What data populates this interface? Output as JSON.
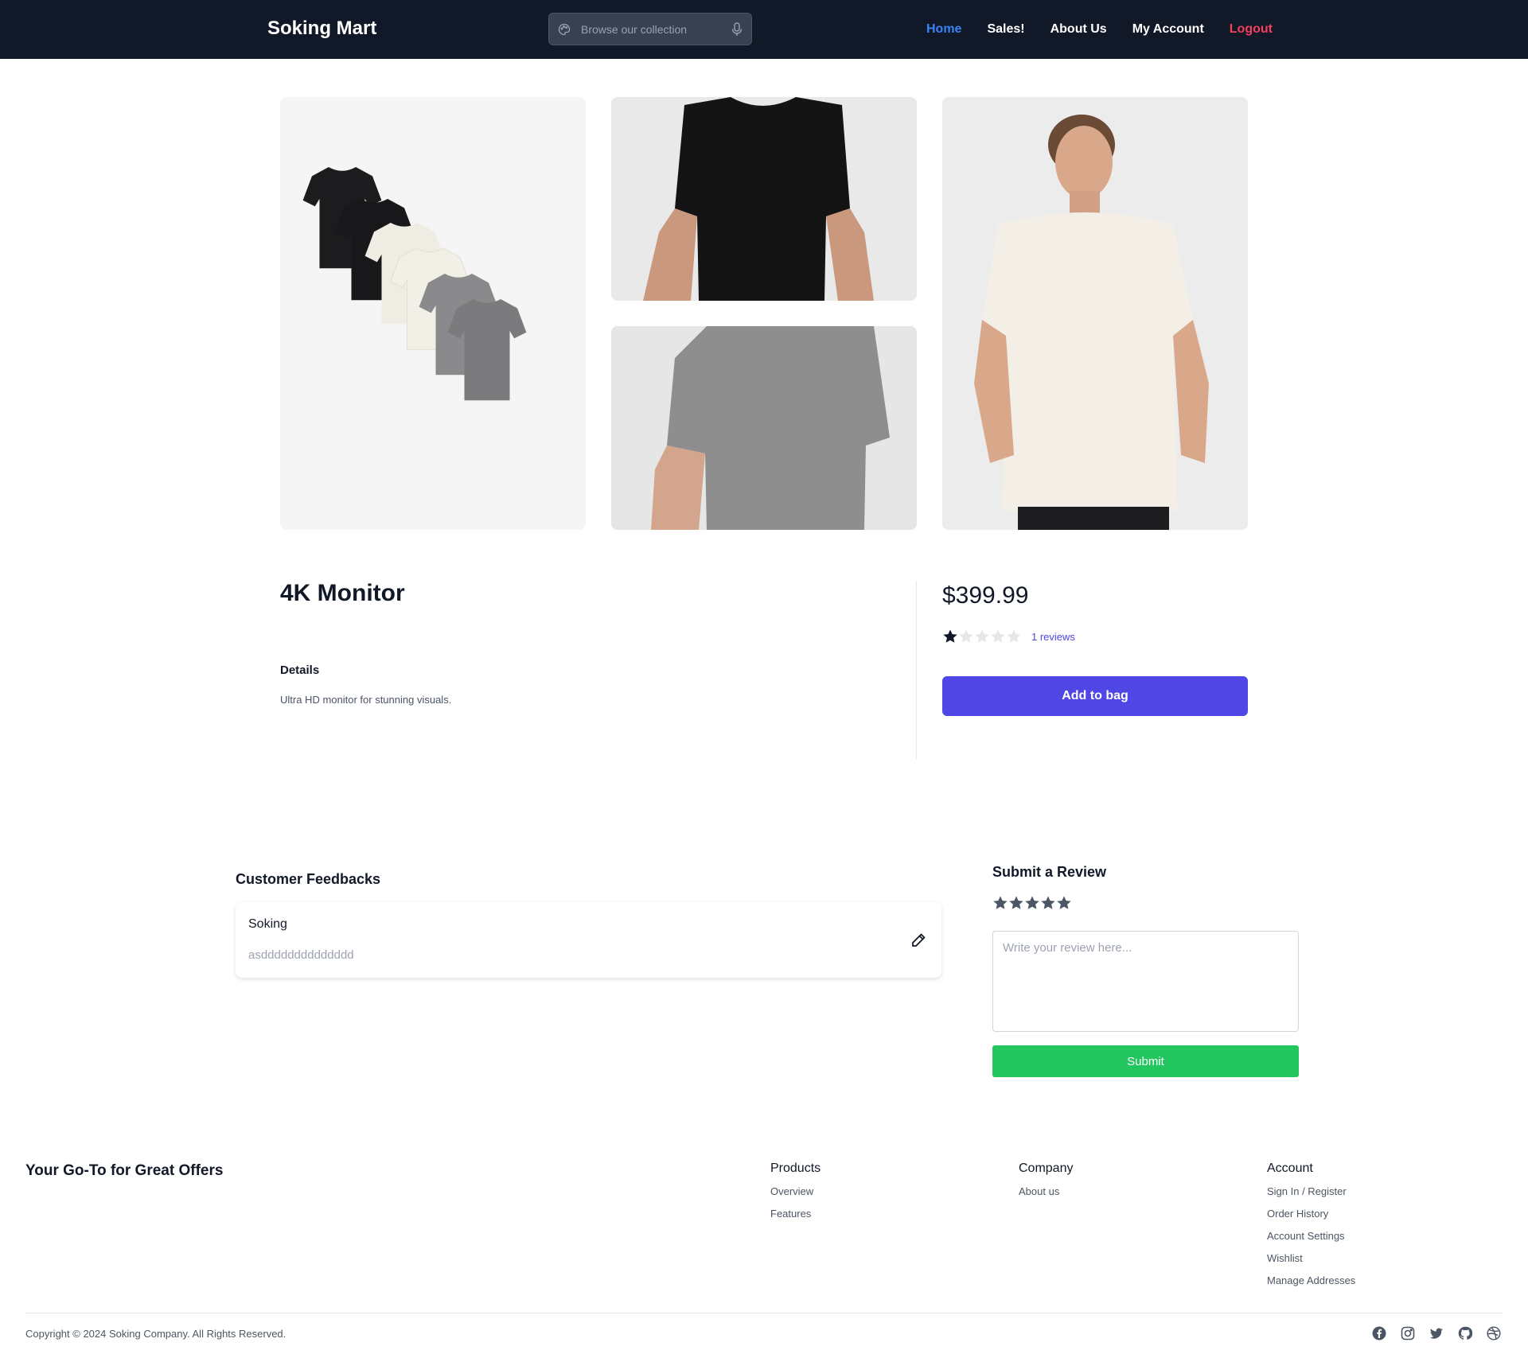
{
  "navbar": {
    "brand": "Soking Mart",
    "search": {
      "placeholder": "Browse our collection"
    },
    "links": [
      {
        "label": "Home",
        "active": true
      },
      {
        "label": "Sales!"
      },
      {
        "label": "About Us"
      },
      {
        "label": "My Account"
      },
      {
        "label": "Logout"
      }
    ]
  },
  "gallery": {
    "images": [
      {
        "name": "tshirt-stack-image",
        "alt": "stack of t-shirts"
      },
      {
        "name": "black-tshirt-image",
        "alt": "black t-shirt"
      },
      {
        "name": "grey-tshirt-image",
        "alt": "grey t-shirt"
      },
      {
        "name": "white-tshirt-model-image",
        "alt": "man in white t-shirt"
      }
    ]
  },
  "product": {
    "title": "4K Monitor",
    "details_heading": "Details",
    "description": "Ultra HD monitor for stunning visuals.",
    "price": "$399.99",
    "rating": 1,
    "rating_max": 5,
    "reviews_text": "1 reviews",
    "add_to_bag": "Add to bag"
  },
  "feedback": {
    "heading": "Customer Feedbacks",
    "items": [
      {
        "name": "Soking",
        "text": "asdddddddddddddd"
      }
    ]
  },
  "review_form": {
    "heading": "Submit a Review",
    "stars": 5,
    "placeholder": "Write your review here...",
    "submit": "Submit"
  },
  "footer": {
    "tagline": "Your Go-To for Great Offers",
    "columns": {
      "products": {
        "title": "Products",
        "links": [
          "Overview",
          "Features"
        ]
      },
      "company": {
        "title": "Company",
        "links": [
          "About us"
        ]
      },
      "account": {
        "title": "Account",
        "links": [
          "Sign In / Register",
          "Order History",
          "Account Settings",
          "Wishlist",
          "Manage Addresses"
        ]
      }
    },
    "copyright": "Copyright © 2024 Soking Company. All Rights Reserved.",
    "social": [
      "facebook-icon",
      "instagram-icon",
      "twitter-icon",
      "github-icon",
      "dribbble-icon"
    ]
  },
  "colors": {
    "nav_bg": "#111827",
    "accent": "#4f46e5",
    "active_link": "#3b82f6",
    "logout": "#f43f5e",
    "submit_green": "#22c55e"
  }
}
